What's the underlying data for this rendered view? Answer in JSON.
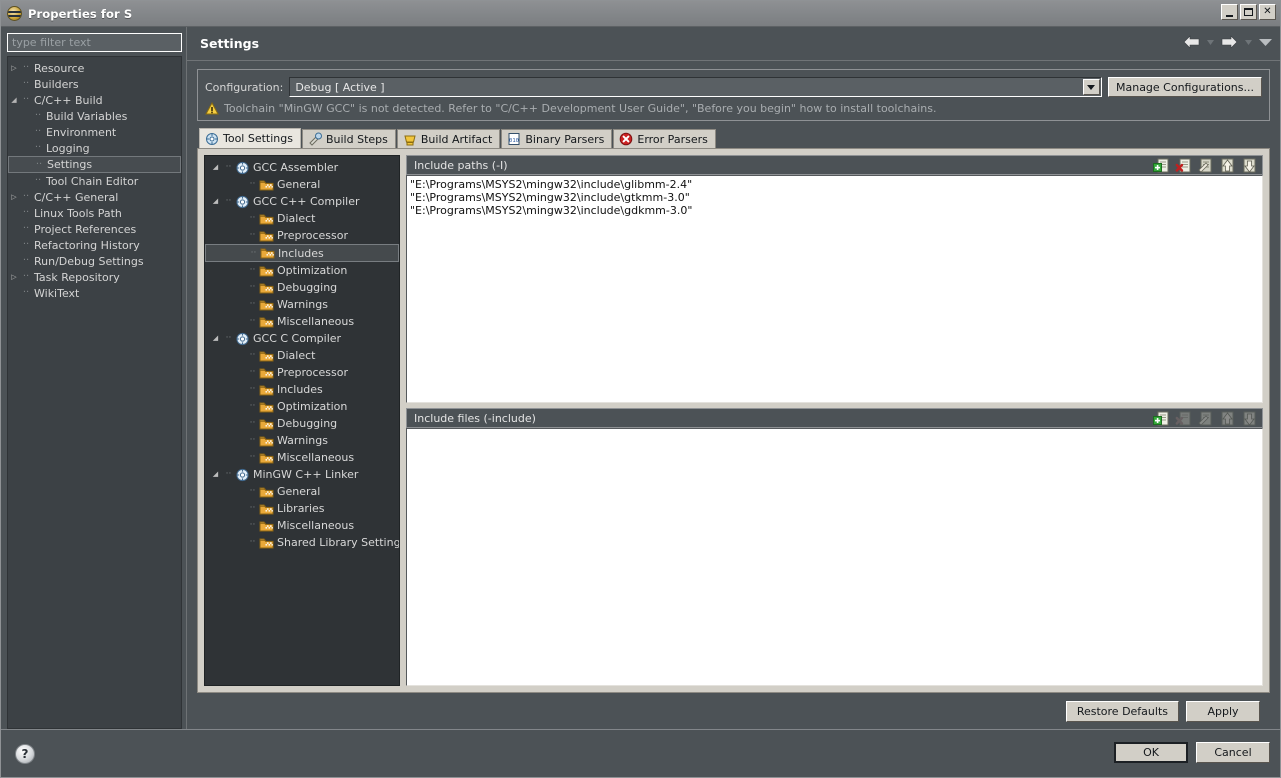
{
  "window": {
    "title": "Properties for S",
    "icon": "eclipse-properties-icon",
    "controls": {
      "minimize": "minimize-button",
      "maximize": "maximize-button",
      "close": "✕"
    }
  },
  "filter": {
    "placeholder": "type filter text",
    "value": ""
  },
  "nav_tree": [
    {
      "label": "Resource",
      "indent": 0,
      "twisty": "collapsed",
      "selected": false
    },
    {
      "label": "Builders",
      "indent": 0,
      "twisty": "none",
      "selected": false
    },
    {
      "label": "C/C++ Build",
      "indent": 0,
      "twisty": "expanded",
      "selected": false
    },
    {
      "label": "Build Variables",
      "indent": 1,
      "twisty": "none",
      "selected": false
    },
    {
      "label": "Environment",
      "indent": 1,
      "twisty": "none",
      "selected": false
    },
    {
      "label": "Logging",
      "indent": 1,
      "twisty": "none",
      "selected": false
    },
    {
      "label": "Settings",
      "indent": 1,
      "twisty": "none",
      "selected": true
    },
    {
      "label": "Tool Chain Editor",
      "indent": 1,
      "twisty": "none",
      "selected": false
    },
    {
      "label": "C/C++ General",
      "indent": 0,
      "twisty": "collapsed",
      "selected": false
    },
    {
      "label": "Linux Tools Path",
      "indent": 0,
      "twisty": "none",
      "selected": false
    },
    {
      "label": "Project References",
      "indent": 0,
      "twisty": "none",
      "selected": false
    },
    {
      "label": "Refactoring History",
      "indent": 0,
      "twisty": "none",
      "selected": false
    },
    {
      "label": "Run/Debug Settings",
      "indent": 0,
      "twisty": "none",
      "selected": false
    },
    {
      "label": "Task Repository",
      "indent": 0,
      "twisty": "collapsed",
      "selected": false
    },
    {
      "label": "WikiText",
      "indent": 0,
      "twisty": "none",
      "selected": false
    }
  ],
  "page": {
    "title": "Settings",
    "nav": {
      "back": "back-arrow",
      "forward": "forward-arrow",
      "history_menu": "history-dropdown",
      "view_menu": "view-menu"
    }
  },
  "configuration": {
    "label": "Configuration:",
    "value": "Debug  [ Active ]",
    "manage_label": "Manage Configurations...",
    "warning": "Toolchain \"MinGW GCC\" is not detected. Refer to \"C/C++ Development User Guide\", \"Before you begin\" how to install toolchains."
  },
  "tabs": [
    {
      "label": "Tool Settings",
      "icon": "tool-settings-icon",
      "active": true
    },
    {
      "label": "Build Steps",
      "icon": "build-steps-icon",
      "active": false
    },
    {
      "label": "Build Artifact",
      "icon": "build-artifact-icon",
      "active": false
    },
    {
      "label": "Binary Parsers",
      "icon": "binary-parsers-icon",
      "active": false
    },
    {
      "label": "Error Parsers",
      "icon": "error-parsers-icon",
      "active": false
    }
  ],
  "tool_tree": [
    {
      "label": "GCC Assembler",
      "indent": 0,
      "twisty": "expanded",
      "icon": "tool-icon",
      "selected": false
    },
    {
      "label": "General",
      "indent": 1,
      "twisty": "none",
      "icon": "folder-icon",
      "selected": false
    },
    {
      "label": "GCC C++ Compiler",
      "indent": 0,
      "twisty": "expanded",
      "icon": "tool-icon",
      "selected": false
    },
    {
      "label": "Dialect",
      "indent": 1,
      "twisty": "none",
      "icon": "folder-icon",
      "selected": false
    },
    {
      "label": "Preprocessor",
      "indent": 1,
      "twisty": "none",
      "icon": "folder-icon",
      "selected": false
    },
    {
      "label": "Includes",
      "indent": 1,
      "twisty": "none",
      "icon": "folder-icon",
      "selected": true
    },
    {
      "label": "Optimization",
      "indent": 1,
      "twisty": "none",
      "icon": "folder-icon",
      "selected": false
    },
    {
      "label": "Debugging",
      "indent": 1,
      "twisty": "none",
      "icon": "folder-icon",
      "selected": false
    },
    {
      "label": "Warnings",
      "indent": 1,
      "twisty": "none",
      "icon": "folder-icon",
      "selected": false
    },
    {
      "label": "Miscellaneous",
      "indent": 1,
      "twisty": "none",
      "icon": "folder-icon",
      "selected": false
    },
    {
      "label": "GCC C Compiler",
      "indent": 0,
      "twisty": "expanded",
      "icon": "tool-icon",
      "selected": false
    },
    {
      "label": "Dialect",
      "indent": 1,
      "twisty": "none",
      "icon": "folder-icon",
      "selected": false
    },
    {
      "label": "Preprocessor",
      "indent": 1,
      "twisty": "none",
      "icon": "folder-icon",
      "selected": false
    },
    {
      "label": "Includes",
      "indent": 1,
      "twisty": "none",
      "icon": "folder-icon",
      "selected": false
    },
    {
      "label": "Optimization",
      "indent": 1,
      "twisty": "none",
      "icon": "folder-icon",
      "selected": false
    },
    {
      "label": "Debugging",
      "indent": 1,
      "twisty": "none",
      "icon": "folder-icon",
      "selected": false
    },
    {
      "label": "Warnings",
      "indent": 1,
      "twisty": "none",
      "icon": "folder-icon",
      "selected": false
    },
    {
      "label": "Miscellaneous",
      "indent": 1,
      "twisty": "none",
      "icon": "folder-icon",
      "selected": false
    },
    {
      "label": "MinGW C++ Linker",
      "indent": 0,
      "twisty": "expanded",
      "icon": "tool-icon",
      "selected": false
    },
    {
      "label": "General",
      "indent": 1,
      "twisty": "none",
      "icon": "folder-icon",
      "selected": false
    },
    {
      "label": "Libraries",
      "indent": 1,
      "twisty": "none",
      "icon": "folder-icon",
      "selected": false
    },
    {
      "label": "Miscellaneous",
      "indent": 1,
      "twisty": "none",
      "icon": "folder-icon",
      "selected": false
    },
    {
      "label": "Shared Library Settings",
      "indent": 1,
      "twisty": "none",
      "icon": "folder-icon",
      "selected": false
    }
  ],
  "include_paths": {
    "label": "Include paths (-I)",
    "tools": [
      "add-icon",
      "delete-icon",
      "edit-icon",
      "move-up-icon",
      "move-down-icon"
    ],
    "values": [
      "\"E:\\Programs\\MSYS2\\mingw32\\include\\glibmm-2.4\"",
      "\"E:\\Programs\\MSYS2\\mingw32\\include\\gtkmm-3.0\"",
      "\"E:\\Programs\\MSYS2\\mingw32\\include\\gdkmm-3.0\""
    ]
  },
  "include_files": {
    "label": "Include files (-include)",
    "tools": [
      "add-icon",
      "delete-icon",
      "edit-icon",
      "move-up-icon",
      "move-down-icon"
    ],
    "values": []
  },
  "page_buttons": {
    "restore_defaults": "Restore Defaults",
    "apply": "Apply"
  },
  "dialog_buttons": {
    "help": "?",
    "ok": "OK",
    "cancel": "Cancel"
  },
  "colors": {
    "window_bg": "#4c5256",
    "tree_bg": "#3c4145",
    "tool_tree_bg": "#2f3336",
    "panel_bg": "#d2cfc7",
    "text_field_bg": "#ffffff",
    "warning_text": "#a9adb0",
    "title_text": "#ffffff"
  }
}
